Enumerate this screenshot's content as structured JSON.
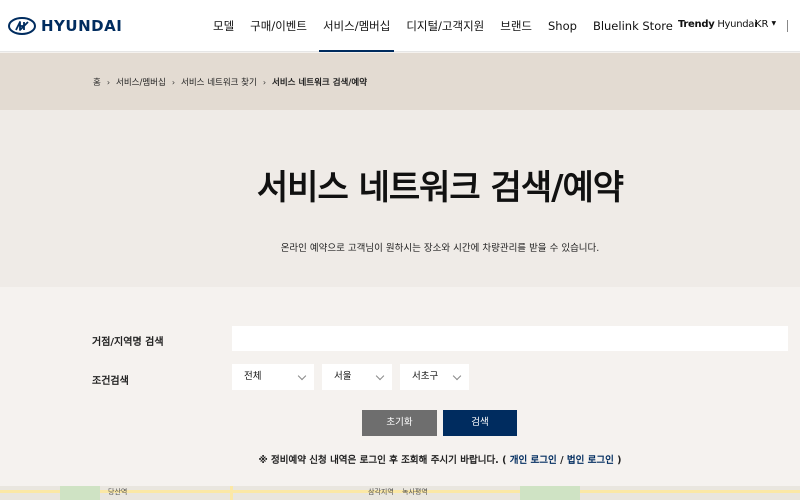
{
  "header": {
    "logo_text": "HYUNDAI",
    "nav": [
      "모델",
      "구매/이벤트",
      "서비스/멤버십",
      "디지털/고객지원",
      "브랜드",
      "Shop",
      "Bluelink Store"
    ],
    "active_nav_index": 2,
    "trendy_bold": "Trendy",
    "trendy_rest": " Hyundai",
    "lang": "KR"
  },
  "breadcrumb": [
    "홈",
    "서비스/멤버십",
    "서비스 네트워크 찾기",
    "서비스 네트워크 검색/예약"
  ],
  "hero": {
    "title": "서비스 네트워크 검색/예약",
    "description": "온라인 예약으로 고객님이 원하시는 장소와 시간에 차량관리를 받을 수 있습니다."
  },
  "form": {
    "search_label": "거점/지역명 검색",
    "search_value": "",
    "search_placeholder": "",
    "condition_label": "조건검색",
    "selects": [
      "전체",
      "서울",
      "서초구"
    ],
    "reset_label": "초기화",
    "search_button_label": "검색"
  },
  "notice": {
    "prefix": "※ 정비예약 신청 내역은 로그인 후 조회해 주시기 바랍니다. ( ",
    "personal_login": "개인 로그인",
    "separator": " / ",
    "corporate_login": "법인 로그인",
    "suffix": " )"
  },
  "map": {
    "labels": [
      "당산역",
      "삼각지역",
      "녹사평역"
    ]
  },
  "colors": {
    "brand": "#002c5f",
    "reset_button": "#6e6e6e",
    "crumb_band": "#e3dbd2",
    "hero_bg": "#efebe7"
  }
}
